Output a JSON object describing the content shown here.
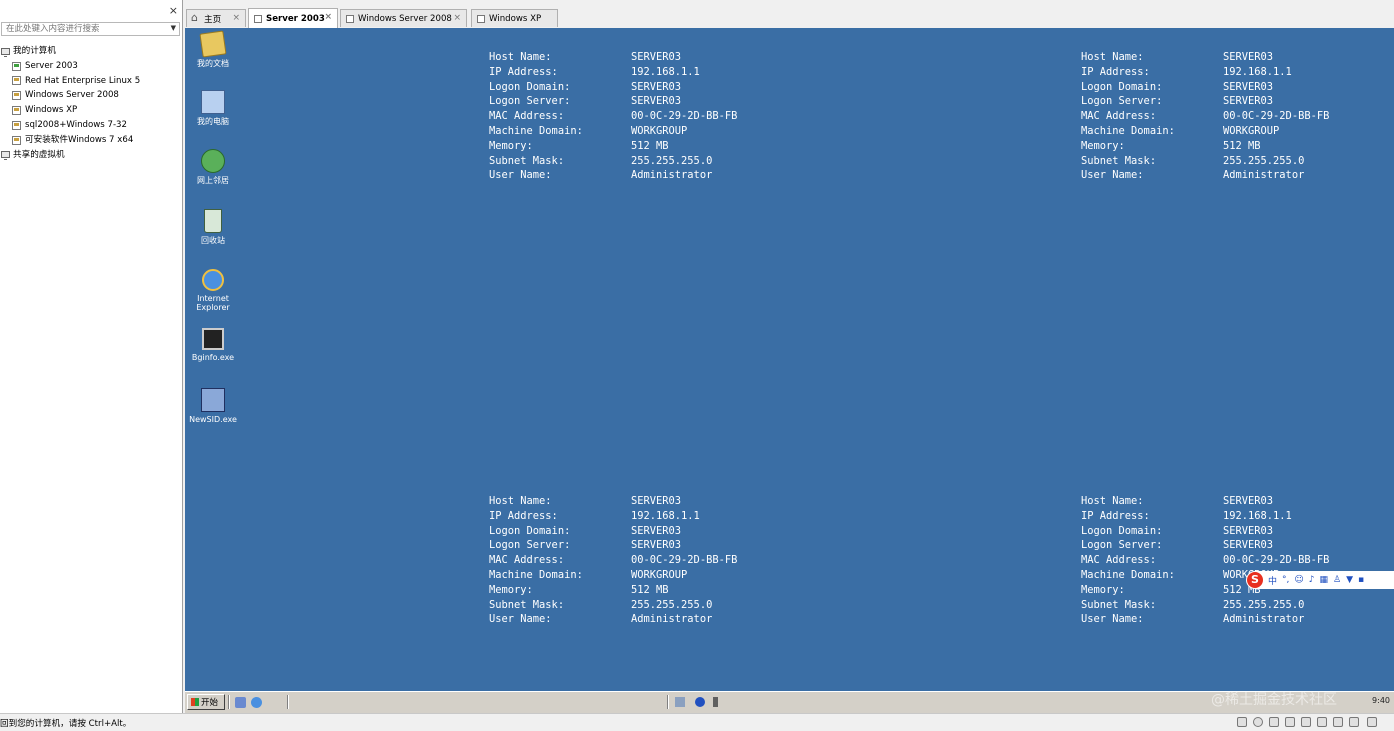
{
  "library": {
    "close_label": "×",
    "search_placeholder": "在此处键入内容进行搜索",
    "tree": {
      "my_computer": "我的计算机",
      "vms": [
        "Server 2003",
        "Red Hat Enterprise Linux 5",
        "Windows Server 2008",
        "Windows XP",
        "sql2008+Windows 7-32",
        "可安装软件Windows 7 x64"
      ],
      "shared": "共享的虚拟机"
    }
  },
  "tabs": [
    {
      "label": "主页",
      "close": "×"
    },
    {
      "label": "Server 2003",
      "close": "×"
    },
    {
      "label": "Windows Server 2008",
      "close": "×"
    },
    {
      "label": "Windows XP",
      "close": ""
    }
  ],
  "desktop_icons": [
    {
      "label": "我的文档",
      "icon": "my-documents-icon"
    },
    {
      "label": "我的电脑",
      "icon": "my-computer-icon"
    },
    {
      "label": "网上邻居",
      "icon": "network-places-icon"
    },
    {
      "label": "回收站",
      "icon": "recycle-bin-icon"
    },
    {
      "label": "Internet Explorer",
      "icon": "internet-explorer-icon"
    },
    {
      "label": "Bginfo.exe",
      "icon": "bginfo-icon"
    },
    {
      "label": "NewSID.exe",
      "icon": "newsid-icon"
    }
  ],
  "bginfo": {
    "labels": [
      "Host Name:",
      "IP Address:",
      "Logon Domain:",
      "Logon Server:",
      "MAC Address:",
      "Machine Domain:",
      "Memory:",
      "Subnet Mask:",
      "User Name:"
    ],
    "values": [
      "SERVER03",
      "192.168.1.1",
      "SERVER03",
      "SERVER03",
      "00-0C-29-2D-BB-FB",
      "WORKGROUP",
      "512 MB",
      "255.255.255.0",
      "Administrator"
    ]
  },
  "taskbar": {
    "start_label": "开始",
    "clock": "9:40",
    "watermark": "@稀土掘金技术社区"
  },
  "ime": {
    "logo": "S",
    "lang": "中"
  },
  "statusbar": {
    "text": "要将输入定向到该虚拟机，请将鼠标指针移入其中或按 Ctrl+G。要返回到您的计算机，请按 Ctrl+Alt。",
    "visible_text": "回到您的计算机，请按 Ctrl+Alt。"
  },
  "colors": {
    "desktop": "#3a6ea5",
    "taskbar": "#d4d0c8"
  }
}
